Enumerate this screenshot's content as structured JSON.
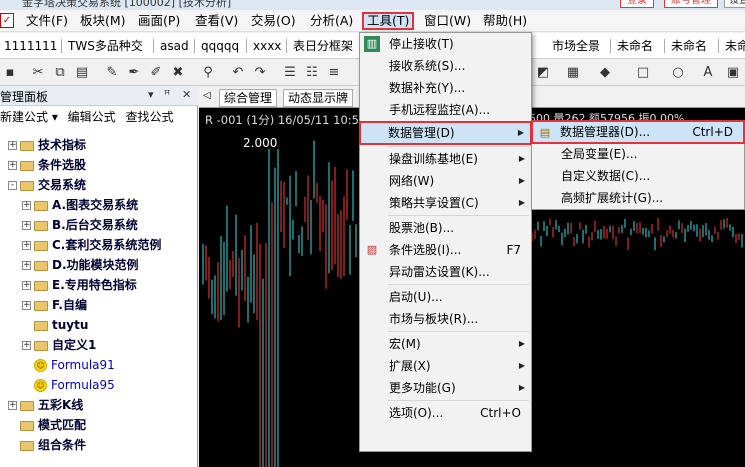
{
  "window": {
    "title": "金字塔决策交易系统 [100002] [技术分析]",
    "btn_a": "登录",
    "btn_b": "账号管理",
    "btn_c": "设置"
  },
  "menubar": {
    "app_icon": "app-logo-icon",
    "items": [
      "文件(F)",
      "板块(M)",
      "画面(P)",
      "查看(V)",
      "交易(O)",
      "分析(A)",
      "工具(T)",
      "窗口(W)",
      "帮助(H)"
    ]
  },
  "tabs": [
    "1111111",
    "TWS多品种交",
    "asad",
    "qqqqq",
    "xxxx",
    "表日分框架",
    "市场全景",
    "未命名",
    "未命名",
    "未命名"
  ],
  "left_panel": {
    "title": "管理面板",
    "pin_text": "▾ ✕",
    "actions": [
      "新建公式 ▾",
      "编辑公式",
      "查找公式"
    ],
    "tree": [
      {
        "label": "技术指标",
        "level": 0,
        "type": "folder",
        "toggle": "+"
      },
      {
        "label": "条件选股",
        "level": 0,
        "type": "folder",
        "toggle": "+"
      },
      {
        "label": "交易系统",
        "level": 0,
        "type": "folder",
        "toggle": "-"
      },
      {
        "label": "A.图表交易系统",
        "level": 1,
        "type": "folder",
        "toggle": "+"
      },
      {
        "label": "B.后台交易系统",
        "level": 1,
        "type": "folder",
        "toggle": "+"
      },
      {
        "label": "C.套利交易系统范例",
        "level": 1,
        "type": "folder",
        "toggle": "+"
      },
      {
        "label": "D.功能模块范例",
        "level": 1,
        "type": "folder",
        "toggle": "+"
      },
      {
        "label": "E.专用特色指标",
        "level": 1,
        "type": "folder",
        "toggle": "+"
      },
      {
        "label": "F.自编",
        "level": 1,
        "type": "folder",
        "toggle": "+"
      },
      {
        "label": "tuytu",
        "level": 1,
        "type": "folder",
        "toggle": ""
      },
      {
        "label": "自定义1",
        "level": 1,
        "type": "folder",
        "toggle": "+"
      },
      {
        "label": "Formula91",
        "level": 1,
        "type": "smile",
        "toggle": ""
      },
      {
        "label": "Formula95",
        "level": 1,
        "type": "smile",
        "toggle": ""
      },
      {
        "label": "五彩K线",
        "level": 0,
        "type": "folder",
        "toggle": "+"
      },
      {
        "label": "模式匹配",
        "level": 0,
        "type": "folder",
        "toggle": ""
      },
      {
        "label": "组合条件",
        "level": 0,
        "type": "folder",
        "toggle": ""
      }
    ]
  },
  "chart": {
    "tabs": [
      "综合管理",
      "动态显示牌"
    ],
    "info": "R -001 (1分) 16/05/11 10:5",
    "info_right": "500 量262 额57956 振0.00%",
    "price_label": "2.000"
  },
  "tools_menu": {
    "items": [
      {
        "label": "停止接收(T)",
        "icon": "receive-icon",
        "arrow": false,
        "shortcut": ""
      },
      {
        "label": "接收系统(S)...",
        "arrow": false,
        "shortcut": ""
      },
      {
        "label": "数据补充(Y)...",
        "arrow": false,
        "shortcut": ""
      },
      {
        "label": "手机远程监控(A)...",
        "arrow": false,
        "shortcut": ""
      },
      {
        "label": "数据管理(D)",
        "arrow": true,
        "shortcut": "",
        "highlight": true
      },
      {
        "sep": true
      },
      {
        "label": "操盘训练基地(E)",
        "arrow": true,
        "shortcut": ""
      },
      {
        "label": "网络(W)",
        "arrow": true,
        "shortcut": ""
      },
      {
        "label": "策略共享设置(C)",
        "arrow": true,
        "shortcut": ""
      },
      {
        "sep": true
      },
      {
        "label": "股票池(B)...",
        "arrow": false,
        "shortcut": ""
      },
      {
        "label": "条件选股(I)...",
        "icon": "screener-icon",
        "arrow": false,
        "shortcut": "F7"
      },
      {
        "label": "异动雷达设置(K)...",
        "arrow": false,
        "shortcut": ""
      },
      {
        "sep": true
      },
      {
        "label": "启动(U)...",
        "arrow": false,
        "shortcut": ""
      },
      {
        "label": "市场与板块(R)...",
        "arrow": false,
        "shortcut": ""
      },
      {
        "sep": true
      },
      {
        "label": "宏(M)",
        "arrow": true,
        "shortcut": ""
      },
      {
        "label": "扩展(X)",
        "arrow": true,
        "shortcut": ""
      },
      {
        "label": "更多功能(G)",
        "arrow": true,
        "shortcut": ""
      },
      {
        "sep": true
      },
      {
        "label": "选项(O)...",
        "arrow": false,
        "shortcut": "Ctrl+O"
      }
    ]
  },
  "data_submenu": {
    "items": [
      {
        "label": "数据管理器(D)...",
        "shortcut": "Ctrl+D",
        "highlight": true
      },
      {
        "label": "全局变量(E)...",
        "shortcut": ""
      },
      {
        "label": "自定义数据(C)...",
        "shortcut": ""
      },
      {
        "label": "高频扩展统计(G)...",
        "shortcut": ""
      }
    ]
  },
  "chart_series": {
    "note_colors": {
      "up": "#ff3b3b",
      "down": "#35e0e0"
    }
  }
}
